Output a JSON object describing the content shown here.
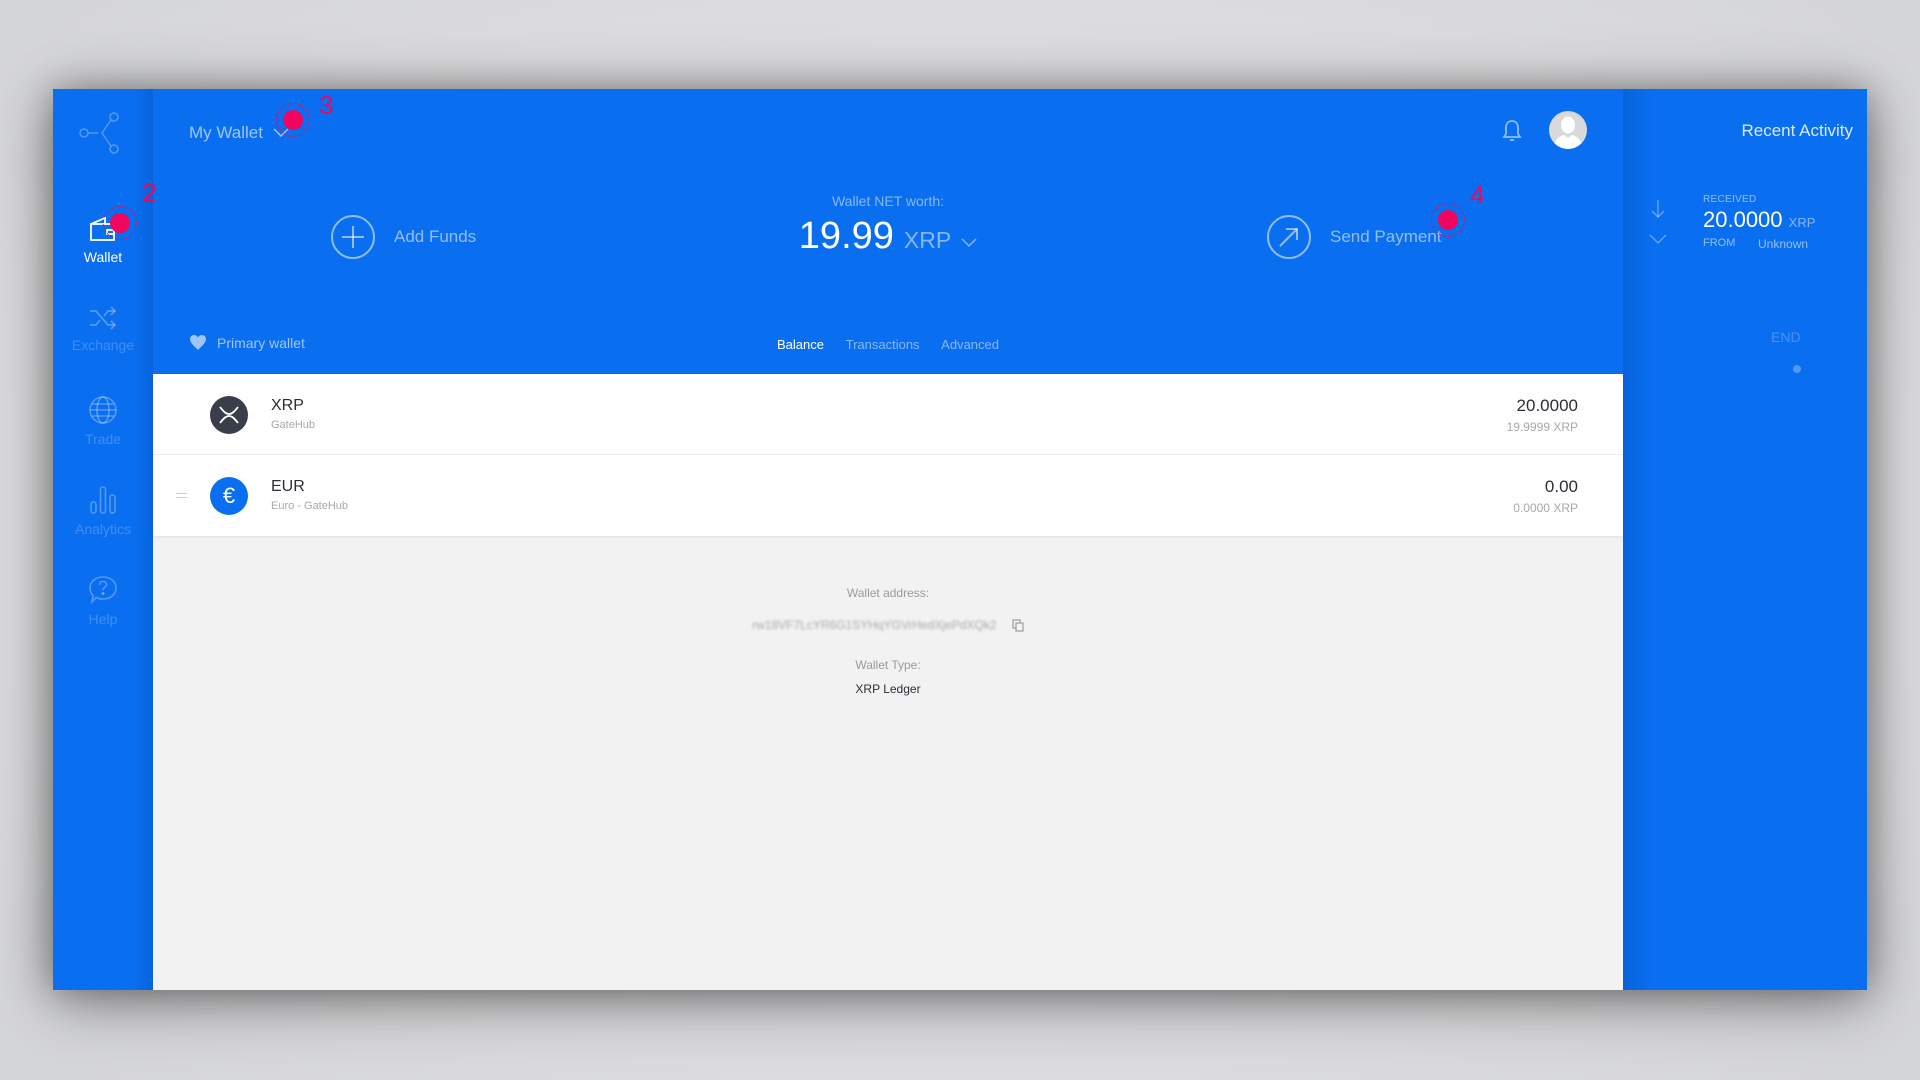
{
  "sidebar": {
    "items": [
      {
        "label": "Wallet",
        "icon": "wallet-icon",
        "active": true
      },
      {
        "label": "Exchange",
        "icon": "shuffle-icon",
        "active": false
      },
      {
        "label": "Trade",
        "icon": "globe-icon",
        "active": false
      },
      {
        "label": "Analytics",
        "icon": "bar-chart-icon",
        "active": false
      },
      {
        "label": "Help",
        "icon": "help-bubble-icon",
        "active": false
      }
    ]
  },
  "header": {
    "wallet_selector": "My Wallet",
    "add_funds": "Add Funds",
    "send_payment": "Send Payment",
    "networth_label": "Wallet NET worth:",
    "networth_value": "19.99",
    "networth_unit": "XRP",
    "primary_wallet": "Primary wallet",
    "tabs": [
      {
        "label": "Balance",
        "active": true
      },
      {
        "label": "Transactions",
        "active": false
      },
      {
        "label": "Advanced",
        "active": false
      }
    ]
  },
  "balances": [
    {
      "symbol": "XRP",
      "issuer": "GateHub",
      "amount": "20.0000",
      "xrp_value": "19.9999 XRP",
      "icon": "xrp-icon",
      "color": "#3a3d4a"
    },
    {
      "symbol": "EUR",
      "issuer": "Euro - GateHub",
      "amount": "0.00",
      "xrp_value": "0.0000 XRP",
      "icon": "euro-icon",
      "color": "#0a6ef0"
    }
  ],
  "wallet_info": {
    "address_label": "Wallet address:",
    "address": "rw18VF7LcYR6G1SYHqYGVrHedXjePdXQk2",
    "type_label": "Wallet Type:",
    "type": "XRP Ledger"
  },
  "activity": {
    "title": "Recent Activity",
    "items": [
      {
        "type": "RECEIVED",
        "amount": "20.0000",
        "unit": "XRP",
        "from_label": "FROM",
        "from": "Unknown"
      }
    ],
    "end_label": "END"
  },
  "annotations": [
    {
      "number": "2"
    },
    {
      "number": "3"
    },
    {
      "number": "4"
    }
  ],
  "colors": {
    "brand_blue": "#0a6ef0",
    "annotation_pink": "#f0065e"
  }
}
